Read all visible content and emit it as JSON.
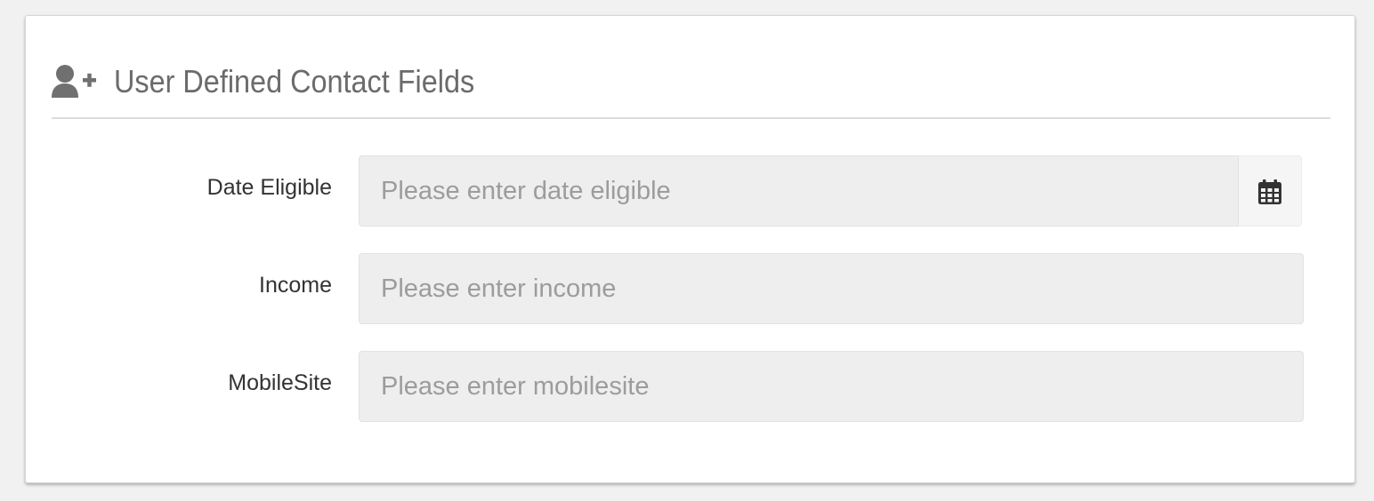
{
  "panel": {
    "title": "User Defined Contact Fields",
    "header_icon": "user-plus-icon"
  },
  "fields": [
    {
      "label": "Date Eligible",
      "value": "",
      "placeholder": "Please enter date eligible",
      "addon_icon": "calendar-icon"
    },
    {
      "label": "Income",
      "value": "",
      "placeholder": "Please enter income"
    },
    {
      "label": "MobileSite",
      "value": "",
      "placeholder": "Please enter mobilesite"
    }
  ],
  "colors": {
    "page_background": "#f1f1f1",
    "panel_background": "#ffffff",
    "title_text": "#6b6b6b",
    "label_text": "#333333",
    "input_background": "#eeeeee",
    "placeholder_text": "#9c9c9c",
    "icon": "#707070"
  }
}
